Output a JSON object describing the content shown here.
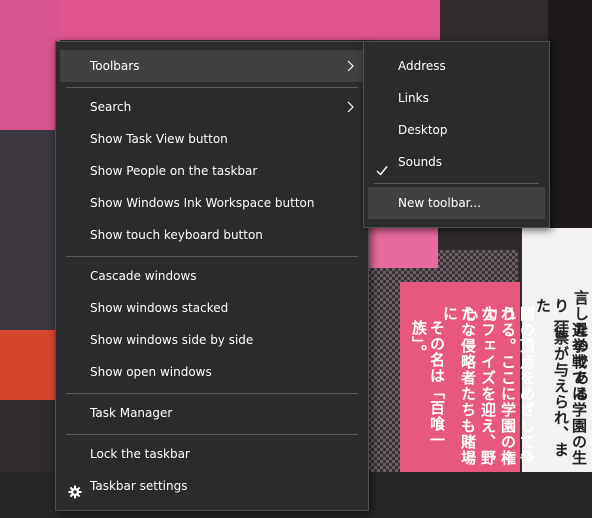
{
  "wallpaper": {
    "columns": [
      "言したのである",
      "選挙戦では学園の生徒",
      "り一票が与えられ、また",
      "園の頂点をめざして争う",
      "れる。ここに学園の権力",
      "なフェイズを迎え、野心",
      "たな侵略者たちも賭場に",
      "その名は「百喰一族」。"
    ]
  },
  "context_menu": {
    "items": [
      {
        "label": "Toolbars",
        "has_submenu": true,
        "highlighted": true
      },
      {
        "label": "Search",
        "has_submenu": true
      },
      {
        "label": "Show Task View button"
      },
      {
        "label": "Show People on the taskbar"
      },
      {
        "label": "Show Windows Ink Workspace button"
      },
      {
        "label": "Show touch keyboard button"
      },
      {
        "label": "Cascade windows"
      },
      {
        "label": "Show windows stacked"
      },
      {
        "label": "Show windows side by side"
      },
      {
        "label": "Show open windows"
      },
      {
        "label": "Task Manager"
      },
      {
        "label": "Lock the taskbar"
      },
      {
        "label": "Taskbar settings",
        "icon": "gear-icon"
      }
    ]
  },
  "toolbars_submenu": {
    "items": [
      {
        "label": "Address",
        "checked": false
      },
      {
        "label": "Links",
        "checked": false
      },
      {
        "label": "Desktop",
        "checked": false
      },
      {
        "label": "Sounds",
        "checked": true,
        "icon": "checkmark-icon"
      },
      {
        "label": "New toolbar...",
        "highlighted": true
      }
    ]
  },
  "colors": {
    "menu_background": "#2b2b2b",
    "menu_highlight": "#414141",
    "menu_border": "#505050",
    "separator": "#5a5a5a",
    "text": "#ffffff"
  }
}
